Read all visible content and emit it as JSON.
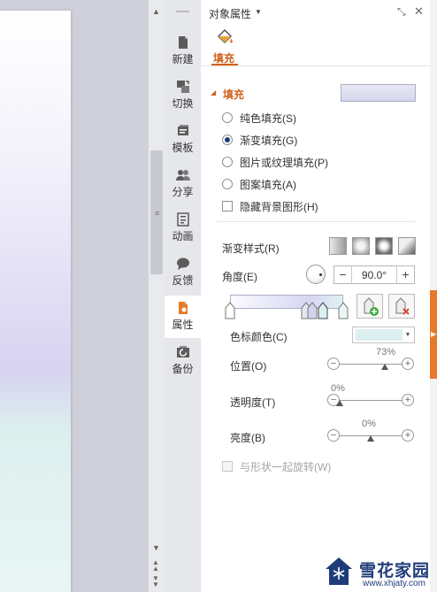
{
  "side_tabs": [
    {
      "label": "新建",
      "icon": "new-doc-icon"
    },
    {
      "label": "切换",
      "icon": "transition-icon"
    },
    {
      "label": "模板",
      "icon": "template-icon"
    },
    {
      "label": "分享",
      "icon": "share-icon"
    },
    {
      "label": "动画",
      "icon": "animation-icon"
    },
    {
      "label": "反馈",
      "icon": "feedback-icon"
    },
    {
      "label": "属性",
      "icon": "properties-icon",
      "active": true
    },
    {
      "label": "备份",
      "icon": "backup-icon"
    }
  ],
  "panel": {
    "title": "对象属性",
    "tab_label": "填充",
    "section_title": "填充",
    "fill_options": {
      "solid": "纯色填充(S)",
      "gradient": "渐变填充(G)",
      "picture": "图片或纹理填充(P)",
      "pattern": "图案填充(A)",
      "hide_background": "隐藏背景图形(H)"
    },
    "selected_fill": "gradient",
    "gradient_style_label": "渐变样式(R)",
    "angle_label": "角度(E)",
    "angle_value": "90.0°",
    "stop_color_label": "色标颜色(C)",
    "position_label": "位置(O)",
    "position_value": "73%",
    "position_fraction": 0.73,
    "transparency_label": "透明度(T)",
    "transparency_value": "0%",
    "transparency_fraction": 0.0,
    "brightness_label": "亮度(B)",
    "brightness_value": "0%",
    "brightness_fraction": 0.5,
    "rotate_with_shape_label": "与形状一起旋转(W)"
  },
  "colors": {
    "accent": "#d2611c",
    "stop_color": "#dceff0",
    "side_handle": "#e77a2a"
  },
  "watermark": {
    "name": "雪花家园",
    "url": "www.xhjaty.com"
  }
}
